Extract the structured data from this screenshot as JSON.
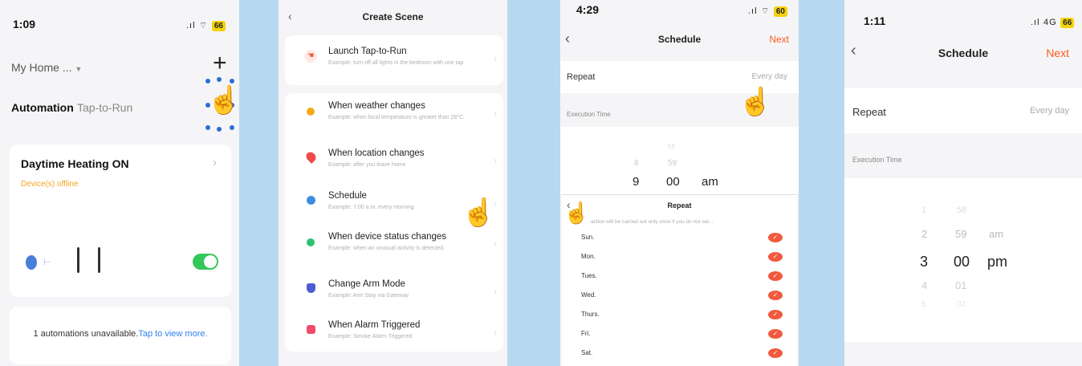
{
  "panel1": {
    "time": "1:09",
    "battery": "66",
    "home_label": "My Home ...",
    "add_icon": "plus-icon",
    "tabs": [
      {
        "label": "Automation"
      },
      {
        "label": "Tap-to-Run"
      }
    ],
    "automation": {
      "title": "Daytime Heating ON",
      "status": "Device(s) offline"
    },
    "unavailable_text": "1 automations unavailable.",
    "tap_link": "Tap to view more."
  },
  "panel2": {
    "title": "Create Scene",
    "items": [
      {
        "title": "Launch Tap-to-Run",
        "subtitle": "Example: turn off all lights in the bedroom with one tap.",
        "icon": "hand-tap-icon",
        "color": "#f05a3e"
      },
      {
        "title": "When weather changes",
        "subtitle": "Example: when local temperature is greater than 28°C.",
        "icon": "sun-icon",
        "color": "#f7a81b"
      },
      {
        "title": "When location changes",
        "subtitle": "Example: after you leave home",
        "icon": "location-pin-icon",
        "color": "#f04b4b"
      },
      {
        "title": "Schedule",
        "subtitle": "Example: 7:00 a.m. every morning",
        "icon": "clock-icon",
        "color": "#3b8fe0"
      },
      {
        "title": "When device status changes",
        "subtitle": "Example: when an unusual activity is detected.",
        "icon": "device-icon",
        "color": "#2fbf71"
      },
      {
        "title": "Change Arm Mode",
        "subtitle": "Example: Arm Stay via Gateway",
        "icon": "shield-icon",
        "color": "#4b5bd6"
      },
      {
        "title": "When Alarm Triggered",
        "subtitle": "Example: Smoke Alarm Triggered",
        "icon": "alarm-icon",
        "color": "#f04b6a"
      }
    ]
  },
  "panel3": {
    "time": "4:29",
    "battery": "60",
    "title": "Schedule",
    "next": "Next",
    "repeat_label": "Repeat",
    "repeat_value": "Every day",
    "execution_label": "Execution Time",
    "picker": {
      "above2": [
        "",
        "58"
      ],
      "above1": [
        "8",
        "59"
      ],
      "hour": "9",
      "minute": "00",
      "ampm": "am"
    },
    "repeat_sheet": {
      "title": "Repeat",
      "note": "action will be carried out only once if you do not set...",
      "days": [
        "Sun.",
        "Mon.",
        "Tues.",
        "Wed.",
        "Thurs.",
        "Fri.",
        "Sat."
      ]
    }
  },
  "panel4": {
    "time": "1:11",
    "network": "4G",
    "battery": "66",
    "title": "Schedule",
    "next": "Next",
    "repeat_label": "Repeat",
    "repeat_value": "Every day",
    "execution_label": "Execution Time",
    "picker": {
      "rows": [
        {
          "h": "",
          "m": "",
          "ap": ""
        },
        {
          "h": "1",
          "m": "58",
          "ap": ""
        },
        {
          "h": "2",
          "m": "59",
          "ap": "am"
        },
        {
          "h": "3",
          "m": "00",
          "ap": "pm"
        },
        {
          "h": "4",
          "m": "01",
          "ap": ""
        },
        {
          "h": "5",
          "m": "02",
          "ap": ""
        }
      ]
    }
  },
  "colors": {
    "accent": "#ff5a1f",
    "toggle_on": "#34c759",
    "link": "#2f80ed",
    "offline": "#f5a623",
    "background": "#b7d9f2"
  }
}
